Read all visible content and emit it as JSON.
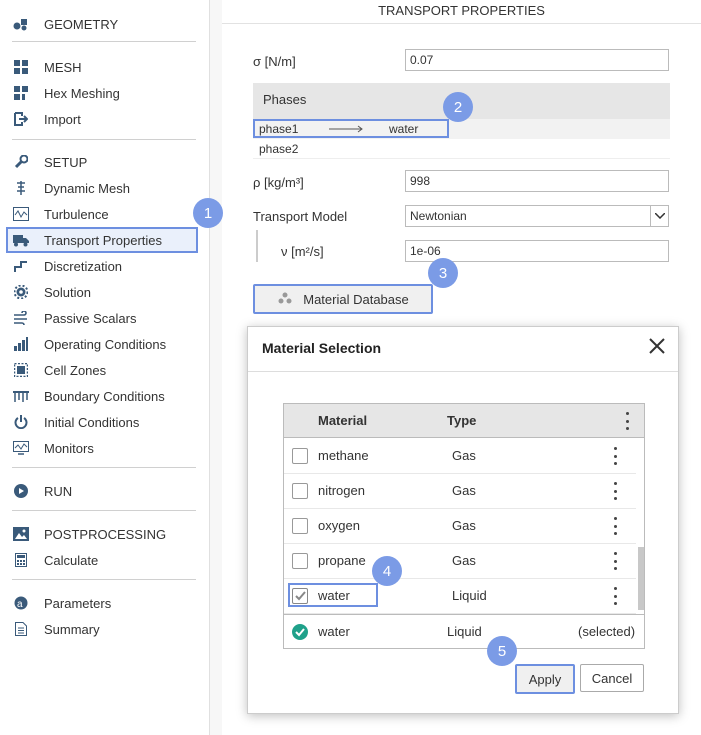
{
  "sidebar": {
    "items": [
      {
        "label": "GEOMETRY",
        "icon": "geometry-icon"
      },
      {
        "label": "MESH",
        "icon": "mesh-icon"
      },
      {
        "label": "Hex Meshing",
        "icon": "hex-meshing-icon"
      },
      {
        "label": "Import",
        "icon": "import-icon"
      },
      {
        "label": "SETUP",
        "icon": "wrench-icon"
      },
      {
        "label": "Dynamic Mesh",
        "icon": "dynamic-mesh-icon"
      },
      {
        "label": "Turbulence",
        "icon": "turbulence-icon"
      },
      {
        "label": "Transport Properties",
        "icon": "truck-icon"
      },
      {
        "label": "Discretization",
        "icon": "discretization-icon"
      },
      {
        "label": "Solution",
        "icon": "gear-icon"
      },
      {
        "label": "Passive Scalars",
        "icon": "wind-icon"
      },
      {
        "label": "Operating Conditions",
        "icon": "bar-chart-icon"
      },
      {
        "label": "Cell Zones",
        "icon": "cell-zones-icon"
      },
      {
        "label": "Boundary Conditions",
        "icon": "boundary-icon"
      },
      {
        "label": "Initial Conditions",
        "icon": "power-icon"
      },
      {
        "label": "Monitors",
        "icon": "monitor-icon"
      },
      {
        "label": "RUN",
        "icon": "play-icon"
      },
      {
        "label": "POSTPROCESSING",
        "icon": "image-icon"
      },
      {
        "label": "Calculate",
        "icon": "calculator-icon"
      },
      {
        "label": "Parameters",
        "icon": "parameters-icon"
      },
      {
        "label": "Summary",
        "icon": "document-icon"
      }
    ]
  },
  "main": {
    "title": "TRANSPORT PROPERTIES",
    "sigma_label": "σ [N/m]",
    "sigma_value": "0.07",
    "phases_header": "Phases",
    "phases": [
      {
        "name": "phase1",
        "material": "water"
      },
      {
        "name": "phase2",
        "material": ""
      }
    ],
    "rho_label": "ρ [kg/m³]",
    "rho_value": "998",
    "transport_model_label": "Transport Model",
    "transport_model_value": "Newtonian",
    "nu_label": "ν [m²/s]",
    "nu_value": "1e-06",
    "material_db_button": "Material Database"
  },
  "dialog": {
    "title": "Material Selection",
    "columns": [
      "Material",
      "Type"
    ],
    "rows": [
      {
        "material": "methane",
        "type": "Gas",
        "checked": false
      },
      {
        "material": "nitrogen",
        "type": "Gas",
        "checked": false
      },
      {
        "material": "oxygen",
        "type": "Gas",
        "checked": false
      },
      {
        "material": "propane",
        "type": "Gas",
        "checked": false
      },
      {
        "material": "water",
        "type": "Liquid",
        "checked": true
      }
    ],
    "selected": {
      "material": "water",
      "type": "Liquid",
      "status": "(selected)"
    },
    "apply_label": "Apply",
    "cancel_label": "Cancel"
  },
  "badges": [
    "1",
    "2",
    "3",
    "4",
    "5"
  ],
  "colors": {
    "accent": "#6d8fe0",
    "badge": "#7b9be6",
    "icon": "#3a5a7a",
    "success": "#1fa18a"
  }
}
